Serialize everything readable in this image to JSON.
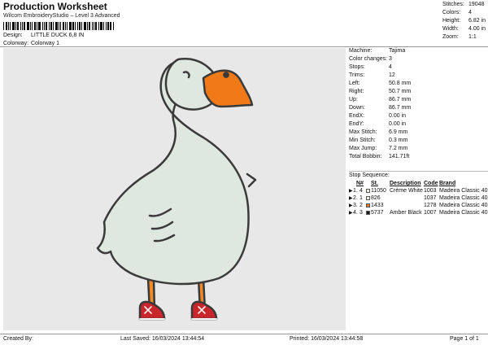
{
  "header": {
    "title": "Production Worksheet",
    "subtitle": "Wilcom EmbroideryStudio – Level 3 Advanced",
    "design_label": "Design:",
    "design_value": "LITTLE DUCK 6,8 IN",
    "colorway_label": "Colorway:",
    "colorway_value": "Colorway 1"
  },
  "summary": [
    {
      "label": "Stitches:",
      "value": "19048"
    },
    {
      "label": "Colors:",
      "value": "4"
    },
    {
      "label": "Height:",
      "value": "6.82 in"
    },
    {
      "label": "Width:",
      "value": "4.00 in"
    },
    {
      "label": "Zoom:",
      "value": "1:1"
    }
  ],
  "info": [
    {
      "label": "Machine:",
      "value": "Tajima"
    },
    {
      "label": "Color changes:",
      "value": "3"
    },
    {
      "label": "Stops:",
      "value": "4"
    },
    {
      "label": "Trims:",
      "value": "12"
    },
    {
      "label": "Left:",
      "value": "50.8 mm"
    },
    {
      "label": "Right:",
      "value": "50.7 mm"
    },
    {
      "label": "Up:",
      "value": "86.7 mm"
    },
    {
      "label": "Down:",
      "value": "86.7 mm"
    },
    {
      "label": "EndX:",
      "value": "0.00 in"
    },
    {
      "label": "EndY:",
      "value": "0.00 in"
    },
    {
      "label": "Max Stitch:",
      "value": "6.9 mm"
    },
    {
      "label": "Min Stitch:",
      "value": "0.3 mm"
    },
    {
      "label": "Max Jump:",
      "value": "7.2 mm"
    },
    {
      "label": "Total Bobbin:",
      "value": "141.71ft"
    }
  ],
  "stop_sequence": {
    "title": "Stop Sequence:",
    "headers": [
      "N#",
      "St.",
      "Description",
      "Code",
      "Brand"
    ],
    "rows": [
      {
        "stop": "1.",
        "n": "4",
        "color": "#f1ece0",
        "stitches": "11050",
        "description": "Crème White",
        "code": "1003",
        "brand": "Madeira Classic 40"
      },
      {
        "stop": "2.",
        "n": "1",
        "color": "#f3eee8",
        "stitches": "826",
        "description": "",
        "code": "1037",
        "brand": "Madeira Classic 40"
      },
      {
        "stop": "3.",
        "n": "2",
        "color": "#f07a18",
        "stitches": "1433",
        "description": "",
        "code": "1278",
        "brand": "Madeira Classic 40"
      },
      {
        "stop": "4.",
        "n": "3",
        "color": "#1a1a1a",
        "stitches": "5737",
        "description": "Amber Black",
        "code": "1007",
        "brand": "Madeira Classic 40"
      }
    ]
  },
  "footer": {
    "created_by": "Created By:",
    "last_saved": "Last Saved: 16/03/2024 13:44:54",
    "printed": "Printed: 16/03/2024 13:44:58",
    "page": "Page 1 of 1"
  }
}
